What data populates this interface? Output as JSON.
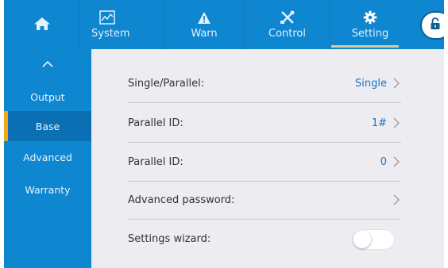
{
  "tabs": [
    {
      "label": "",
      "icon": "home-icon"
    },
    {
      "label": "System",
      "icon": "system-chart-icon"
    },
    {
      "label": "Warn",
      "icon": "warning-icon"
    },
    {
      "label": "Control",
      "icon": "tools-icon"
    },
    {
      "label": "Setting",
      "icon": "gear-icon",
      "active": true
    }
  ],
  "lock": {
    "icon": "unlock-icon"
  },
  "sidebar": {
    "up_icon": "chevron-up-icon",
    "items": [
      {
        "label": "Output"
      },
      {
        "label": "Base",
        "active": true
      },
      {
        "label": "Advanced"
      },
      {
        "label": "Warranty"
      }
    ]
  },
  "settings": [
    {
      "label": "Single/Parallel:",
      "value": "Single"
    },
    {
      "label": "Parallel ID:",
      "value": "1#"
    },
    {
      "label": "Parallel ID:",
      "value": "0"
    },
    {
      "label": "Advanced password:",
      "value": ""
    },
    {
      "label": "Settings wizard:",
      "toggle": false
    }
  ],
  "colors": {
    "bar": "#0f86d0",
    "accent": "#f3a51e",
    "value_text": "#1a73c7",
    "content_bg": "#ececf1"
  }
}
